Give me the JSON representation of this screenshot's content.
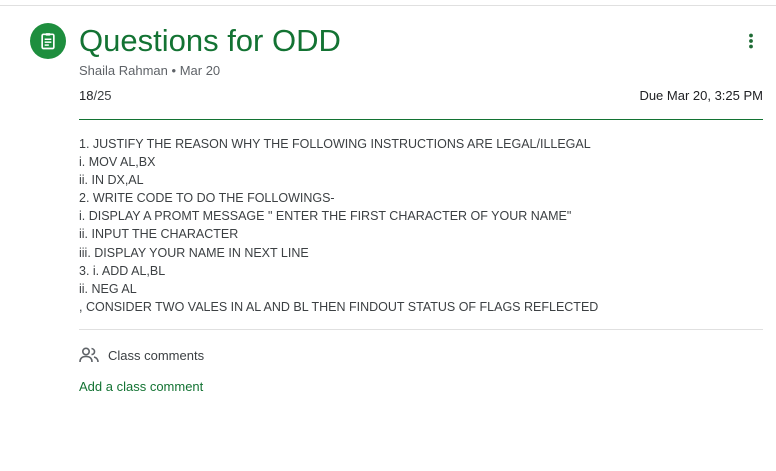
{
  "assignment": {
    "icon": "assignment-icon",
    "title": "Questions for ODD",
    "author": "Shaila Rahman",
    "separator": "•",
    "posted_date": "Mar 20",
    "points_earned": "18",
    "points_total": "/25",
    "due": "Due Mar 20, 3:25 PM",
    "accent_color": "#137333"
  },
  "instructions": [
    "1. JUSTIFY THE REASON WHY THE FOLLOWING INSTRUCTIONS ARE LEGAL/ILLEGAL",
    "i. MOV AL,BX",
    "ii. IN DX,AL",
    "2. WRITE CODE TO DO THE FOLLOWINGS-",
    "i. DISPLAY A PROMT MESSAGE \" ENTER THE FIRST CHARACTER OF YOUR NAME\"",
    "ii. INPUT THE CHARACTER",
    "iii. DISPLAY YOUR NAME IN NEXT LINE",
    "3. i. ADD AL,BL",
    "ii. NEG AL",
    ", CONSIDER TWO VALES IN AL AND BL THEN FINDOUT STATUS OF FLAGS REFLECTED"
  ],
  "comments": {
    "icon": "people-icon",
    "label": "Class comments",
    "add_label": "Add a class comment"
  },
  "menu": {
    "icon": "more-vert-icon"
  }
}
